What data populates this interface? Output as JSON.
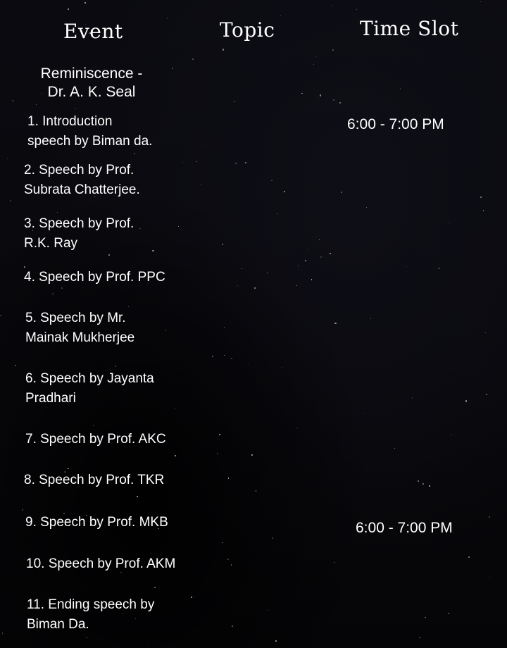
{
  "headers": {
    "event": "Event",
    "topic": "Topic",
    "time_slot": "Time Slot"
  },
  "event_title": "Reminiscence -\nDr. A. K. Seal",
  "items": [
    "1. Introduction\nspeech by Biman da.",
    "2. Speech by Prof.\nSubrata Chatterjee.",
    "3. Speech by Prof.\nR.K. Ray",
    "4. Speech by Prof. PPC",
    "5. Speech by Mr.\nMainak Mukherjee",
    "6. Speech by Jayanta\nPradhari",
    "7. Speech by Prof. AKC",
    "8. Speech by Prof. TKR",
    "9. Speech by Prof. MKB",
    "10. Speech by Prof. AKM",
    "11. Ending speech by\nBiman Da."
  ],
  "time_slots": [
    "6:00 - 7:00 PM",
    "6:00 - 7:00 PM"
  ]
}
